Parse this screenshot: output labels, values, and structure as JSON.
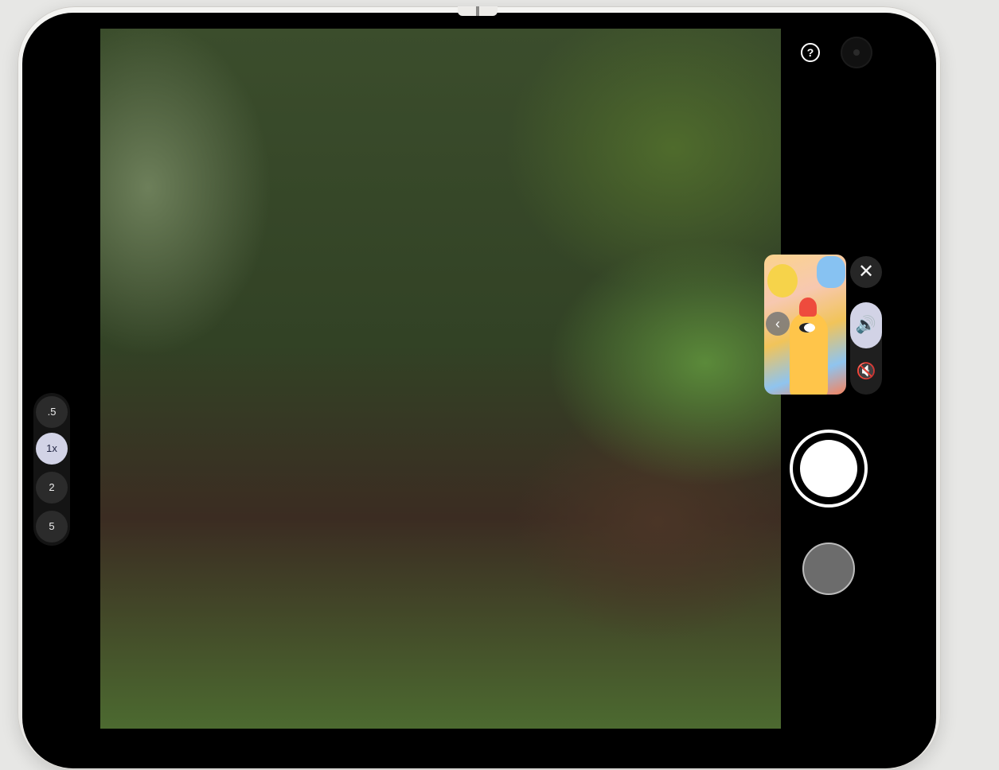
{
  "camera": {
    "zoom_levels": [
      ".5",
      "1x",
      "2",
      "5"
    ],
    "active_zoom": "1x",
    "help_glyph": "?",
    "close_glyph": "✕",
    "back_glyph": "‹",
    "sound_on_glyph": "🔊",
    "sound_off_glyph": "🔇",
    "icons": {
      "help": "help-icon",
      "front_camera": "front-camera-icon",
      "close": "close-icon",
      "back": "chevron-left-icon",
      "sound_on": "volume-icon",
      "sound_off": "volume-off-icon"
    },
    "colors": {
      "active_chip": "#d2d3e6",
      "panel_bg": "#1f1f1f",
      "shutter_ring": "#ffffff"
    }
  }
}
